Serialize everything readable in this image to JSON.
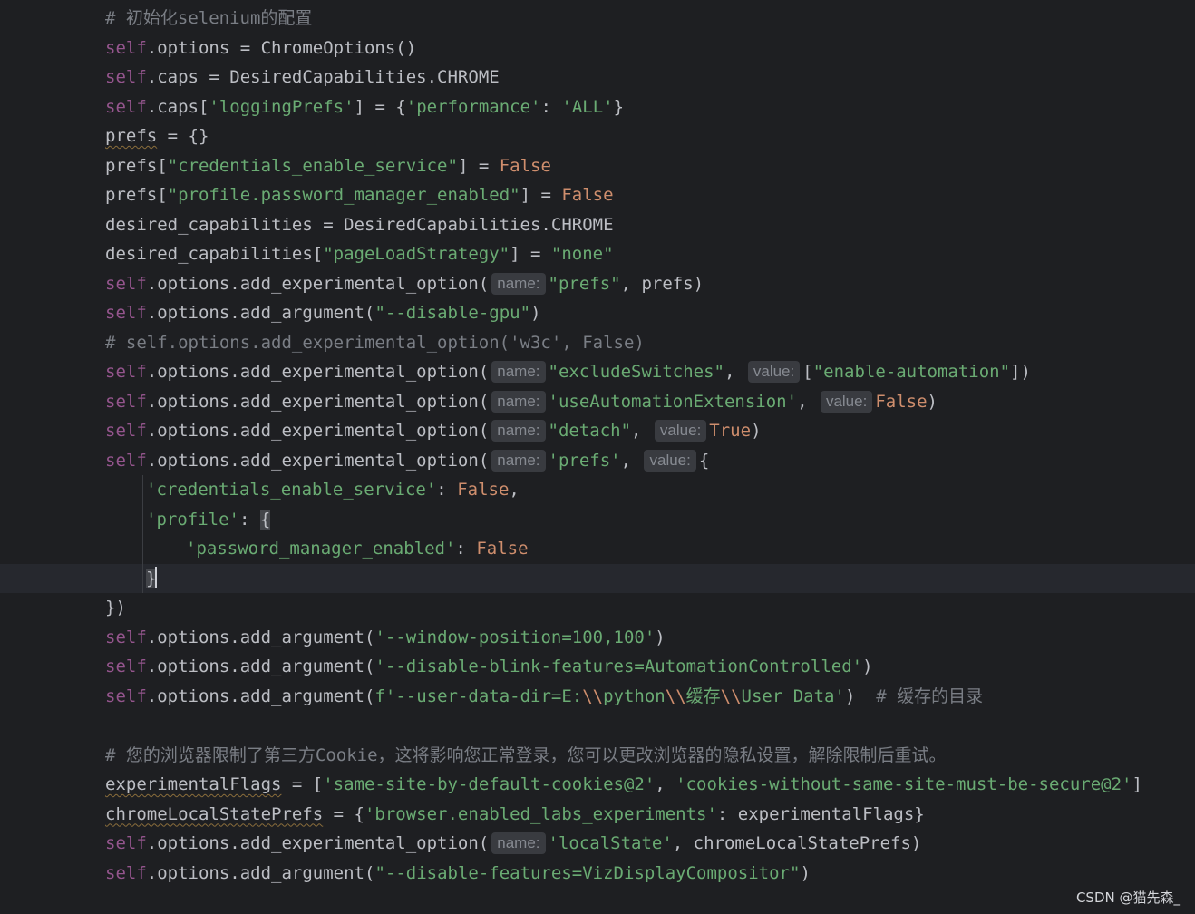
{
  "editor": {
    "lines": {
      "l01": "# 初始化selenium的配置",
      "l02_self": "self",
      "l02_rest": ".options = ChromeOptions()",
      "l03_self": "self",
      "l03_rest": ".caps = DesiredCapabilities.CHROME",
      "l04_self": "self",
      "l04_a": ".caps[",
      "l04_s1": "'loggingPrefs'",
      "l04_b": "] = {",
      "l04_s2": "'performance'",
      "l04_c": ": ",
      "l04_s3": "'ALL'",
      "l04_d": "}",
      "l05_var": "prefs",
      "l05_rest": " = {}",
      "l06_a": "prefs[",
      "l06_s": "\"credentials_enable_service\"",
      "l06_b": "] = ",
      "l06_v": "False",
      "l07_a": "prefs[",
      "l07_s": "\"profile.password_manager_enabled\"",
      "l07_b": "] = ",
      "l07_v": "False",
      "l08": "desired_capabilities = DesiredCapabilities.CHROME",
      "l09_a": "desired_capabilities[",
      "l09_s1": "\"pageLoadStrategy\"",
      "l09_b": "] = ",
      "l09_s2": "\"none\"",
      "l10_self": "self",
      "l10_a": ".options.add_experimental_option(",
      "l10_h": "name:",
      "l10_s": "\"prefs\"",
      "l10_b": ", prefs)",
      "l11_self": "self",
      "l11_a": ".options.add_argument(",
      "l11_s": "\"--disable-gpu\"",
      "l11_b": ")",
      "l12": "# self.options.add_experimental_option('w3c', False)",
      "l13_self": "self",
      "l13_a": ".options.add_experimental_option(",
      "l13_h1": "name:",
      "l13_s1": "\"excludeSwitches\"",
      "l13_b": ", ",
      "l13_h2": "value:",
      "l13_c": "[",
      "l13_s2": "\"enable-automation\"",
      "l13_d": "])",
      "l14_self": "self",
      "l14_a": ".options.add_experimental_option(",
      "l14_h1": "name:",
      "l14_s1": "'useAutomationExtension'",
      "l14_b": ", ",
      "l14_h2": "value:",
      "l14_v": "False",
      "l14_d": ")",
      "l15_self": "self",
      "l15_a": ".options.add_experimental_option(",
      "l15_h1": "name:",
      "l15_s1": "\"detach\"",
      "l15_b": ", ",
      "l15_h2": "value:",
      "l15_v": "True",
      "l15_d": ")",
      "l16_self": "self",
      "l16_a": ".options.add_experimental_option(",
      "l16_h1": "name:",
      "l16_s1": "'prefs'",
      "l16_b": ", ",
      "l16_h2": "value:",
      "l16_d": "{",
      "l17_s": "'credentials_enable_service'",
      "l17_a": ": ",
      "l17_v": "False",
      "l17_b": ",",
      "l18_s": "'profile'",
      "l18_a": ": ",
      "l18_b": "{",
      "l19_s": "'password_manager_enabled'",
      "l19_a": ": ",
      "l19_v": "False",
      "l20_b": "}",
      "l21": "})",
      "l22_self": "self",
      "l22_a": ".options.add_argument(",
      "l22_s": "'--window-position=100,100'",
      "l22_b": ")",
      "l23_self": "self",
      "l23_a": ".options.add_argument(",
      "l23_s": "'--disable-blink-features=AutomationControlled'",
      "l23_b": ")",
      "l24_self": "self",
      "l24_a": ".options.add_argument(",
      "l24_s1": "f'--user-data-dir=E:",
      "l24_e1": "\\\\",
      "l24_s2": "python",
      "l24_e2": "\\\\",
      "l24_s3": "缓存",
      "l24_e3": "\\\\",
      "l24_s4": "User Data'",
      "l24_b": ")  ",
      "l24_c": "# 缓存的目录",
      "l25": "",
      "l26": "# 您的浏览器限制了第三方Cookie，这将影响您正常登录，您可以更改浏览器的隐私设置，解除限制后重试。",
      "l27_var": "experimentalFlags",
      "l27_a": " = [",
      "l27_s1": "'same-site-by-default-cookies@2'",
      "l27_b": ", ",
      "l27_s2": "'cookies-without-same-site-must-be-secure@2'",
      "l27_c": "]",
      "l28_var": "chromeLocalStatePrefs",
      "l28_a": " = {",
      "l28_s": "'browser.enabled_labs_experiments'",
      "l28_b": ": experimentalFlags}",
      "l29_self": "self",
      "l29_a": ".options.add_experimental_option(",
      "l29_h": "name:",
      "l29_s": "'localState'",
      "l29_b": ", chromeLocalStatePrefs)",
      "l30_self": "self",
      "l30_a": ".options.add_argument(",
      "l30_s": "\"--disable-features=VizDisplayCompositor\"",
      "l30_b": ")"
    }
  },
  "watermark": "CSDN @猫先森_",
  "colors": {
    "background": "#1e1f22",
    "keyword_self": "#94558d",
    "string": "#6aab73",
    "boolean": "#cf8e6d",
    "comment": "#7a7e85",
    "text": "#bcbec4"
  },
  "icons": {
    "gutter": "lightbulb-icon"
  }
}
